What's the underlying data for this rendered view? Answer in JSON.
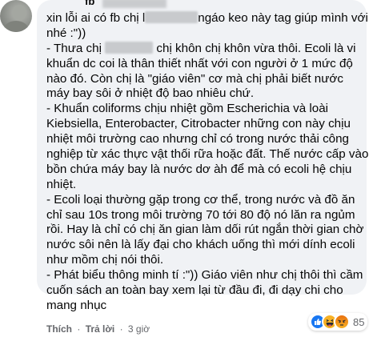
{
  "comment": {
    "author_visible": "fb",
    "lines": [
      {
        "before": "xin lỗi ai có fb chị l",
        "redacted": true,
        "after": "ngáo keo này tag giúp mình với"
      },
      {
        "text": "nhé :\"))"
      },
      {
        "before": "- Thưa chị ",
        "redacted": true,
        "after": " chị khôn chị khôn vừa thôi. Ecoli là vi"
      },
      {
        "text": "khuẩn dc coi là thân thiết nhất với con người ở 1 mức độ"
      },
      {
        "text": "nào đó. Còn chị là \"giáo viên\" cơ mà chị phải biết nước"
      },
      {
        "text": "máy bay sôi ở nhiệt độ bao nhiêu chứ."
      },
      {
        "text": "- Khuẩn coliforms chịu nhiệt gồm Escherichia và loài"
      },
      {
        "text": "Kiebsiella, Enterobacter, Citrobacter những con này chịu"
      },
      {
        "text": "nhiệt môi trường cao nhưng chỉ có trong nước thải công"
      },
      {
        "text": "nghiệp từ xác thực vật thối rữa hoặc đất. Thế nước cấp vào"
      },
      {
        "text": "bồn chứa máy bay là nước dơ àh để mà có ecoli hệ chịu"
      },
      {
        "text": "nhiệt."
      },
      {
        "text": "- Ecoli loại thường gặp trong cơ thể, trong nước và đồ ăn"
      },
      {
        "text": "chỉ sau 10s trong môi trường 70 tới 80 độ nó lăn ra ngủm"
      },
      {
        "text": "rồi. Hay là chỉ có chị ăn gian làm dối rút ngắn thời gian chờ"
      },
      {
        "text": "nước sôi nên là lấy đại cho khách uống thì mới dính ecoli"
      },
      {
        "text": "như mồm chị nói thôi."
      },
      {
        "text": "- Phát biểu thông minh tí :\")) Giáo viên như chị thôi thì cầm"
      },
      {
        "text": "cuốn sách an toàn bay xem lại từ đầu đi, đi dạy chi cho"
      },
      {
        "text": "mang nhục"
      }
    ]
  },
  "actions": {
    "like_label": "Thích",
    "reply_label": "Trả lời",
    "separator": "·",
    "time": "3 giờ"
  },
  "reactions": {
    "icons": [
      "like-icon",
      "haha-icon",
      "angry-icon"
    ],
    "count": "85"
  }
}
